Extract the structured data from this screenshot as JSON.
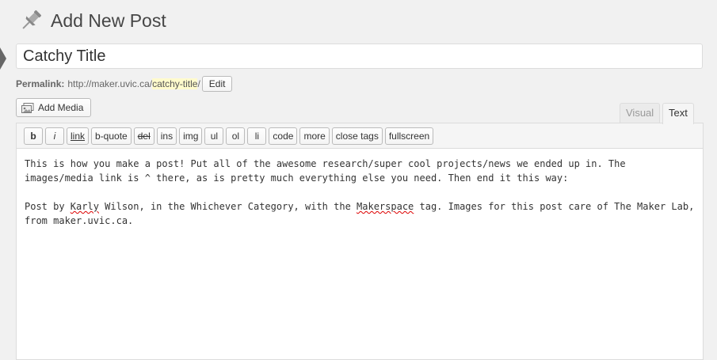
{
  "header": {
    "title": "Add New Post",
    "icon": "pushpin-icon"
  },
  "post_title": {
    "value": "Catchy Title"
  },
  "permalink": {
    "label": "Permalink:",
    "base": "http://maker.uvic.ca/",
    "slug": "catchy-title",
    "trail": "/",
    "edit_label": "Edit"
  },
  "media": {
    "add_label": "Add Media",
    "icon": "media-icon"
  },
  "tabs": {
    "visual": "Visual",
    "text": "Text",
    "active": "Text"
  },
  "toolbar": {
    "buttons": [
      "b",
      "i",
      "link",
      "b-quote",
      "del",
      "ins",
      "img",
      "ul",
      "ol",
      "li",
      "code",
      "more",
      "close tags",
      "fullscreen"
    ]
  },
  "content": {
    "p1": "This is how you make a post! Put all of the awesome research/super cool projects/news we ended up in. The images/media link is ^ there, as is pretty much everything else you need. Then end it this way:",
    "p2_a": "Post by ",
    "p2_b": "Karly",
    "p2_c": " Wilson, in the Whichever Category, with the ",
    "p2_d": "Makerspace",
    "p2_e": " tag. Images for this post care of The Maker Lab, from maker.uvic.ca."
  },
  "colors": {
    "slug_highlight": "#fffbcc",
    "spellcheck": "#dd0000"
  }
}
